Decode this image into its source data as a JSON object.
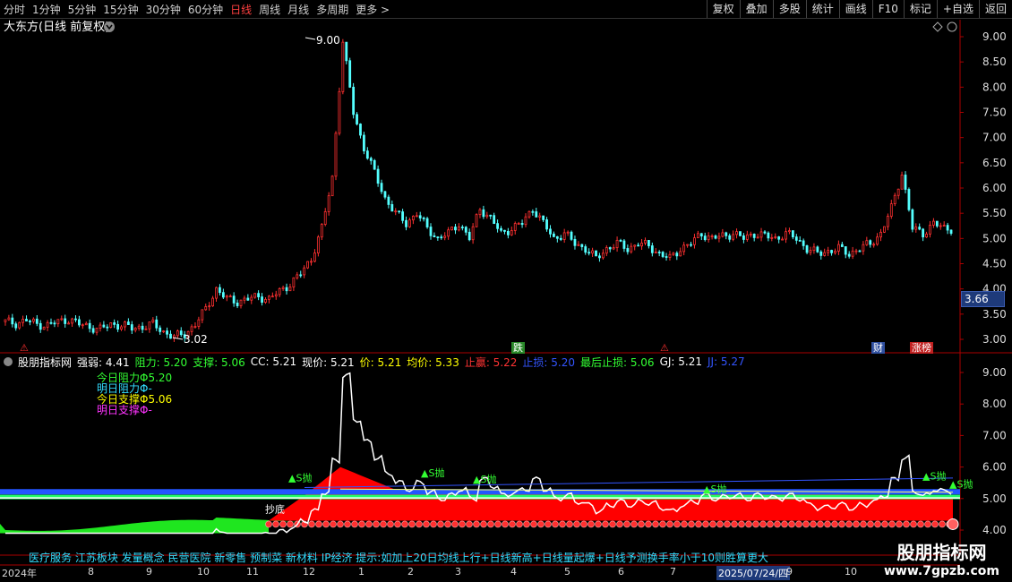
{
  "toolbar": {
    "periods": [
      "分时",
      "1分钟",
      "5分钟",
      "15分钟",
      "30分钟",
      "60分钟",
      "日线",
      "周线",
      "月线",
      "多周期",
      "更多 >"
    ],
    "active_period": "日线",
    "right_buttons": [
      "复权",
      "叠加",
      "多股",
      "统计",
      "画线",
      "F10",
      "标记",
      "+自选",
      "返回"
    ]
  },
  "chart_header": {
    "title": "大东方(日线 前复权)"
  },
  "price_axis": [
    "9.00",
    "8.50",
    "8.00",
    "7.50",
    "7.00",
    "6.50",
    "6.00",
    "5.50",
    "5.00",
    "4.50",
    "4.00",
    "3.50",
    "3.00"
  ],
  "current_price_tag": "3.66",
  "annotations": {
    "high": "9.00",
    "low": "3.02"
  },
  "event_markers": [
    {
      "text": "跌",
      "color": "#2a8a2a"
    },
    {
      "text": "财",
      "color": "#3050a0"
    },
    {
      "text": "涨榜",
      "color": "#c02020"
    }
  ],
  "indicator_header": {
    "name": "股朋指标网",
    "items": [
      {
        "label": "强弱: 4.41",
        "color": "#ffffff"
      },
      {
        "label": "阻力: 5.20",
        "color": "#33ff33"
      },
      {
        "label": "支撑: 5.06",
        "color": "#33ff33"
      },
      {
        "label": "CC: 5.21",
        "color": "#ffffff"
      },
      {
        "label": "现价: 5.21",
        "color": "#ffffff"
      },
      {
        "label": "价: 5.21",
        "color": "#ffff00"
      },
      {
        "label": "均价: 5.33",
        "color": "#ffff00"
      },
      {
        "label": "止赢: 5.22",
        "color": "#ff3333"
      },
      {
        "label": "止损: 5.20",
        "color": "#3355ff"
      },
      {
        "label": "最后止损: 5.06",
        "color": "#33ff33"
      },
      {
        "label": "GJ: 5.21",
        "color": "#ffffff"
      },
      {
        "label": "JJ: 5.27",
        "color": "#3355ff"
      }
    ]
  },
  "indicator_legend": [
    {
      "label": "今日阻力Φ5.20",
      "color": "#33ff33"
    },
    {
      "label": "明日阻力Φ-",
      "color": "#33ddff"
    },
    {
      "label": "今日支撑Φ5.06",
      "color": "#ffff00"
    },
    {
      "label": "明日支撑Φ-",
      "color": "#ff33ff"
    }
  ],
  "indicator_axis": [
    "9.00",
    "8.00",
    "7.00",
    "6.00",
    "5.00",
    "4.00"
  ],
  "signals": [
    "S抛",
    "S抛",
    "S抛",
    "S抛",
    "S抛",
    "S抛",
    "抄底"
  ],
  "bottom_text": "医疗服务 江苏板块 发量概念 民营医院 新零售 预制菜 新材料 IP经济 提示:如加上20日均线上行+日线新高+日线量起爆+日线予测换手率小于10则胜算更大",
  "x_labels": [
    "2024年",
    "8",
    "9",
    "10",
    "11",
    "12",
    "1",
    "2",
    "3",
    "4",
    "5",
    "6",
    "7",
    "2025/07/24/四",
    "9",
    "10"
  ],
  "watermark": {
    "line1": "股朋指标网",
    "line2": "www.7gpzb.com"
  },
  "colors": {
    "up": "#ff3030",
    "down": "#54ffff",
    "fill_red": "#ff0000",
    "fill_green": "#22ff22",
    "band_blue": "#2255ff"
  },
  "chart_data": {
    "type": "candlestick",
    "title": "大东方(日线 前复权)",
    "ylim": [
      2.8,
      9.2
    ],
    "x_labels": [
      "2024年",
      "8",
      "9",
      "10",
      "11",
      "12",
      "1",
      "2",
      "3",
      "4",
      "5",
      "6",
      "7",
      "2025/07/24/四",
      "9",
      "10"
    ],
    "close": [
      3.35,
      3.32,
      3.38,
      3.3,
      3.28,
      3.35,
      3.4,
      3.3,
      3.25,
      3.2,
      3.3,
      3.28,
      3.22,
      3.25,
      3.3,
      3.15,
      3.05,
      3.1,
      3.3,
      3.6,
      4.0,
      3.8,
      3.75,
      3.8,
      3.85,
      3.8,
      3.95,
      4.1,
      4.3,
      4.6,
      5.2,
      6.2,
      8.9,
      7.5,
      6.8,
      6.3,
      5.8,
      5.5,
      5.3,
      5.5,
      5.2,
      5.0,
      5.1,
      5.3,
      5.0,
      5.6,
      5.4,
      5.1,
      5.2,
      5.3,
      5.6,
      5.3,
      5.0,
      5.1,
      4.9,
      4.8,
      4.6,
      4.8,
      4.9,
      4.8,
      4.9,
      4.85,
      4.7,
      4.6,
      4.8,
      4.9,
      5.1,
      5.0,
      5.05,
      5.1,
      5.0,
      5.1,
      5.05,
      5.0,
      5.1,
      5.0,
      4.8,
      4.7,
      4.75,
      4.8,
      4.7,
      4.8,
      4.9,
      5.1,
      5.6,
      6.3,
      5.2,
      5.1,
      5.3,
      5.2
    ],
    "annotations": {
      "high": "9.00",
      "low": "3.02"
    }
  }
}
